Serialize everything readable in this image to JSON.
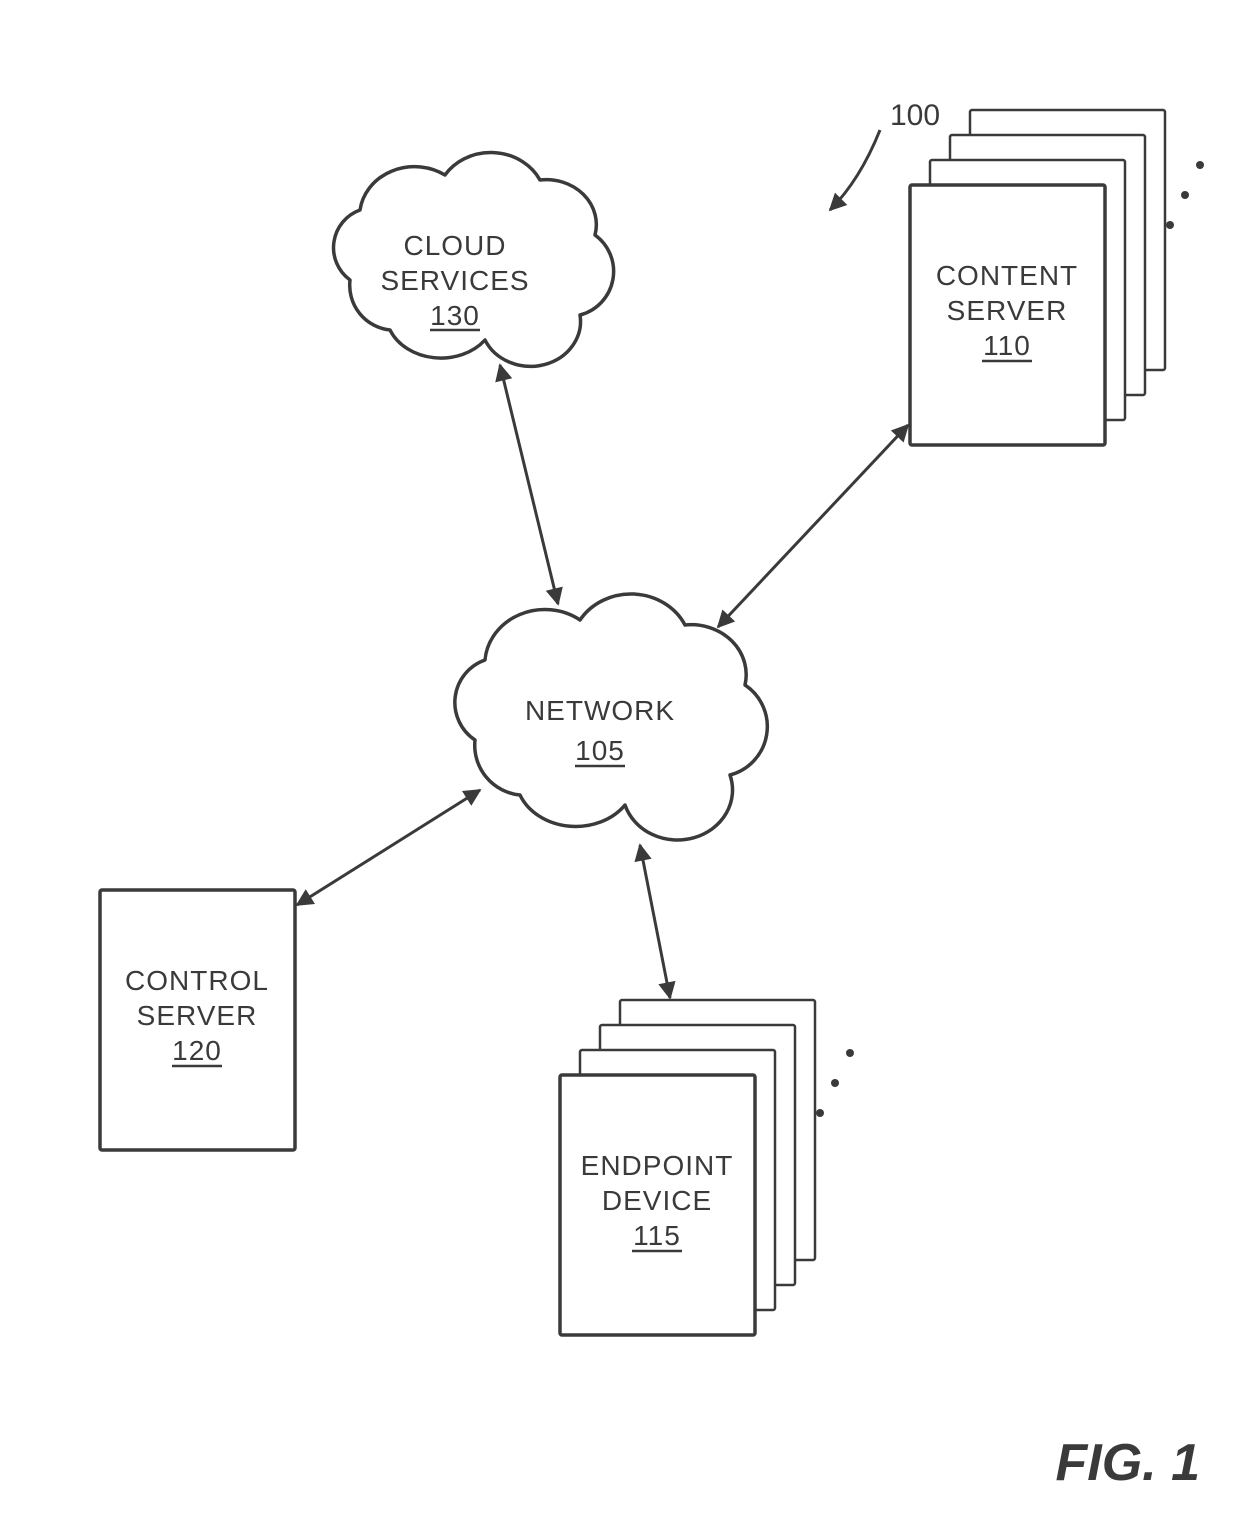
{
  "figure_label": "FIG. 1",
  "callout": "100",
  "network": {
    "label": "NETWORK",
    "num": "105"
  },
  "cloud_services": {
    "label1": "CLOUD",
    "label2": "SERVICES",
    "num": "130"
  },
  "control_server": {
    "label1": "CONTROL",
    "label2": "SERVER",
    "num": "120"
  },
  "content_server": {
    "label1": "CONTENT",
    "label2": "SERVER",
    "num": "110"
  },
  "endpoint_device": {
    "label1": "ENDPOINT",
    "label2": "DEVICE",
    "num": "115"
  }
}
